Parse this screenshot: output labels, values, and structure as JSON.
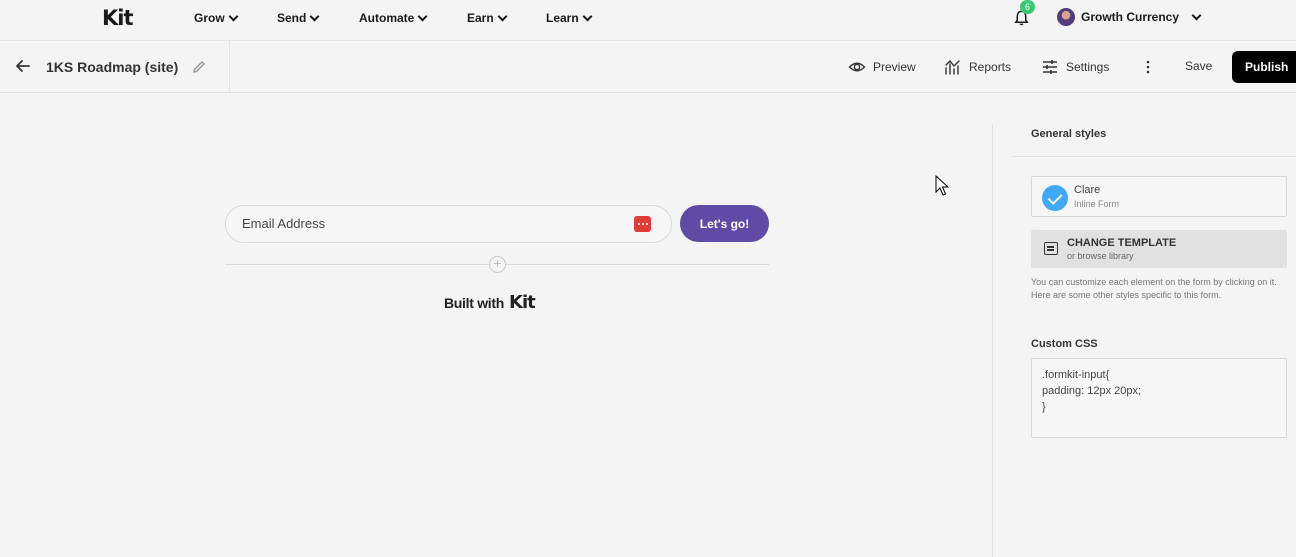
{
  "brand": {
    "logo_text": "Kit",
    "accent": "#5f4aa6",
    "success": "#3cc774"
  },
  "nav": {
    "items": [
      {
        "label": "Grow"
      },
      {
        "label": "Send"
      },
      {
        "label": "Automate"
      },
      {
        "label": "Earn"
      },
      {
        "label": "Learn"
      }
    ],
    "notifications_count": "6",
    "account_name": "Growth Currency"
  },
  "editor": {
    "title": "1KS Roadmap (site)",
    "preview_label": "Preview",
    "reports_label": "Reports",
    "settings_label": "Settings",
    "save_label": "Save",
    "publish_label": "Publish"
  },
  "form": {
    "email_placeholder": "Email Address",
    "submit_label": "Let's go!",
    "built_with_label": "Built with",
    "built_with_brand": "Kit"
  },
  "panel": {
    "title": "General styles",
    "template_name": "Clare",
    "template_type": "Inline Form",
    "change_template_title": "CHANGE TEMPLATE",
    "change_template_sub": "or browse library",
    "help_text": "You can customize each element on the form by clicking on it. Here are some other styles specific to this form.",
    "custom_css_label": "Custom CSS",
    "custom_css_lines": [
      ".formkit-input{",
      "padding: 12px 20px;",
      "}"
    ]
  }
}
